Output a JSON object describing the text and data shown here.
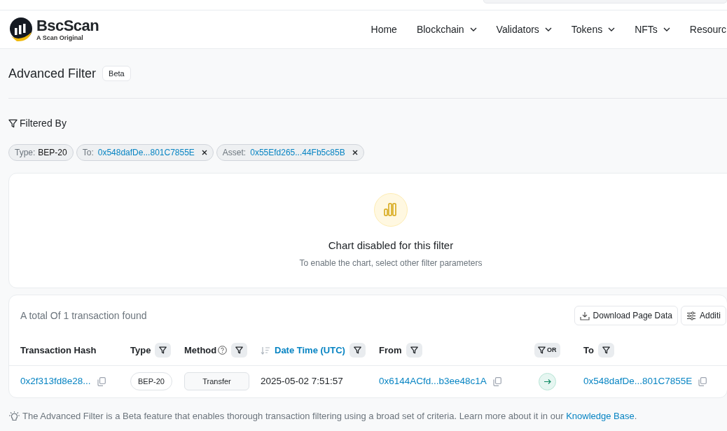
{
  "header": {
    "logo_name": "BscScan",
    "logo_tagline": "A Scan Original",
    "nav": [
      {
        "label": "Home",
        "dropdown": false
      },
      {
        "label": "Blockchain",
        "dropdown": true
      },
      {
        "label": "Validators",
        "dropdown": true
      },
      {
        "label": "Tokens",
        "dropdown": true
      },
      {
        "label": "NFTs",
        "dropdown": true
      },
      {
        "label": "Resourc",
        "dropdown": false
      }
    ]
  },
  "page": {
    "title": "Advanced Filter",
    "badge": "Beta"
  },
  "filters": {
    "label": "Filtered By",
    "chips": [
      {
        "key": "Type:",
        "value": "BEP-20",
        "link": false,
        "removable": false
      },
      {
        "key": "To:",
        "value": "0x548dafDe...801C7855E",
        "link": true,
        "removable": true
      },
      {
        "key": "Asset:",
        "value": "0x55Efd265...44Fb5c85B",
        "link": true,
        "removable": true
      }
    ]
  },
  "chart_panel": {
    "title": "Chart disabled for this filter",
    "subtitle": "To enable the chart, select other filter parameters"
  },
  "table": {
    "summary": "A total Of 1 transaction found",
    "buttons": [
      {
        "label": "Download Page Data",
        "kind": "download"
      },
      {
        "label": "Additi",
        "kind": "settings"
      }
    ],
    "columns": [
      {
        "label": "Transaction Hash",
        "filter": false,
        "help": false,
        "sorted": false
      },
      {
        "label": "Type",
        "filter": true,
        "help": false,
        "sorted": false
      },
      {
        "label": "Method",
        "filter": true,
        "help": true,
        "sorted": false
      },
      {
        "label": "Date Time (UTC)",
        "filter": true,
        "help": false,
        "sorted": true
      },
      {
        "label": "From",
        "filter": true,
        "help": false,
        "sorted": false
      },
      {
        "label": "OR",
        "filter": true,
        "help": false,
        "sorted": false
      },
      {
        "label": "To",
        "filter": true,
        "help": false,
        "sorted": false
      }
    ],
    "rows": [
      [
        {
          "kind": "link",
          "text": "0x2f313fd8e28...",
          "copy": true
        },
        {
          "kind": "pill",
          "text": "BEP-20"
        },
        {
          "kind": "method",
          "text": "Transfer"
        },
        {
          "kind": "text",
          "text": "2025-05-02 7:51:57"
        },
        {
          "kind": "link",
          "text": "0x6144ACfd...b3ee48c1A",
          "copy": true
        },
        {
          "kind": "arrow"
        },
        {
          "kind": "link",
          "text": "0x548dafDe...801C7855E",
          "copy": true
        }
      ]
    ]
  },
  "footer": {
    "text": "The Advanced Filter is a Beta feature that enables thorough transaction filtering using a broad set of criteria. Learn more about it in our ",
    "link": "Knowledge Base",
    "after": "."
  }
}
